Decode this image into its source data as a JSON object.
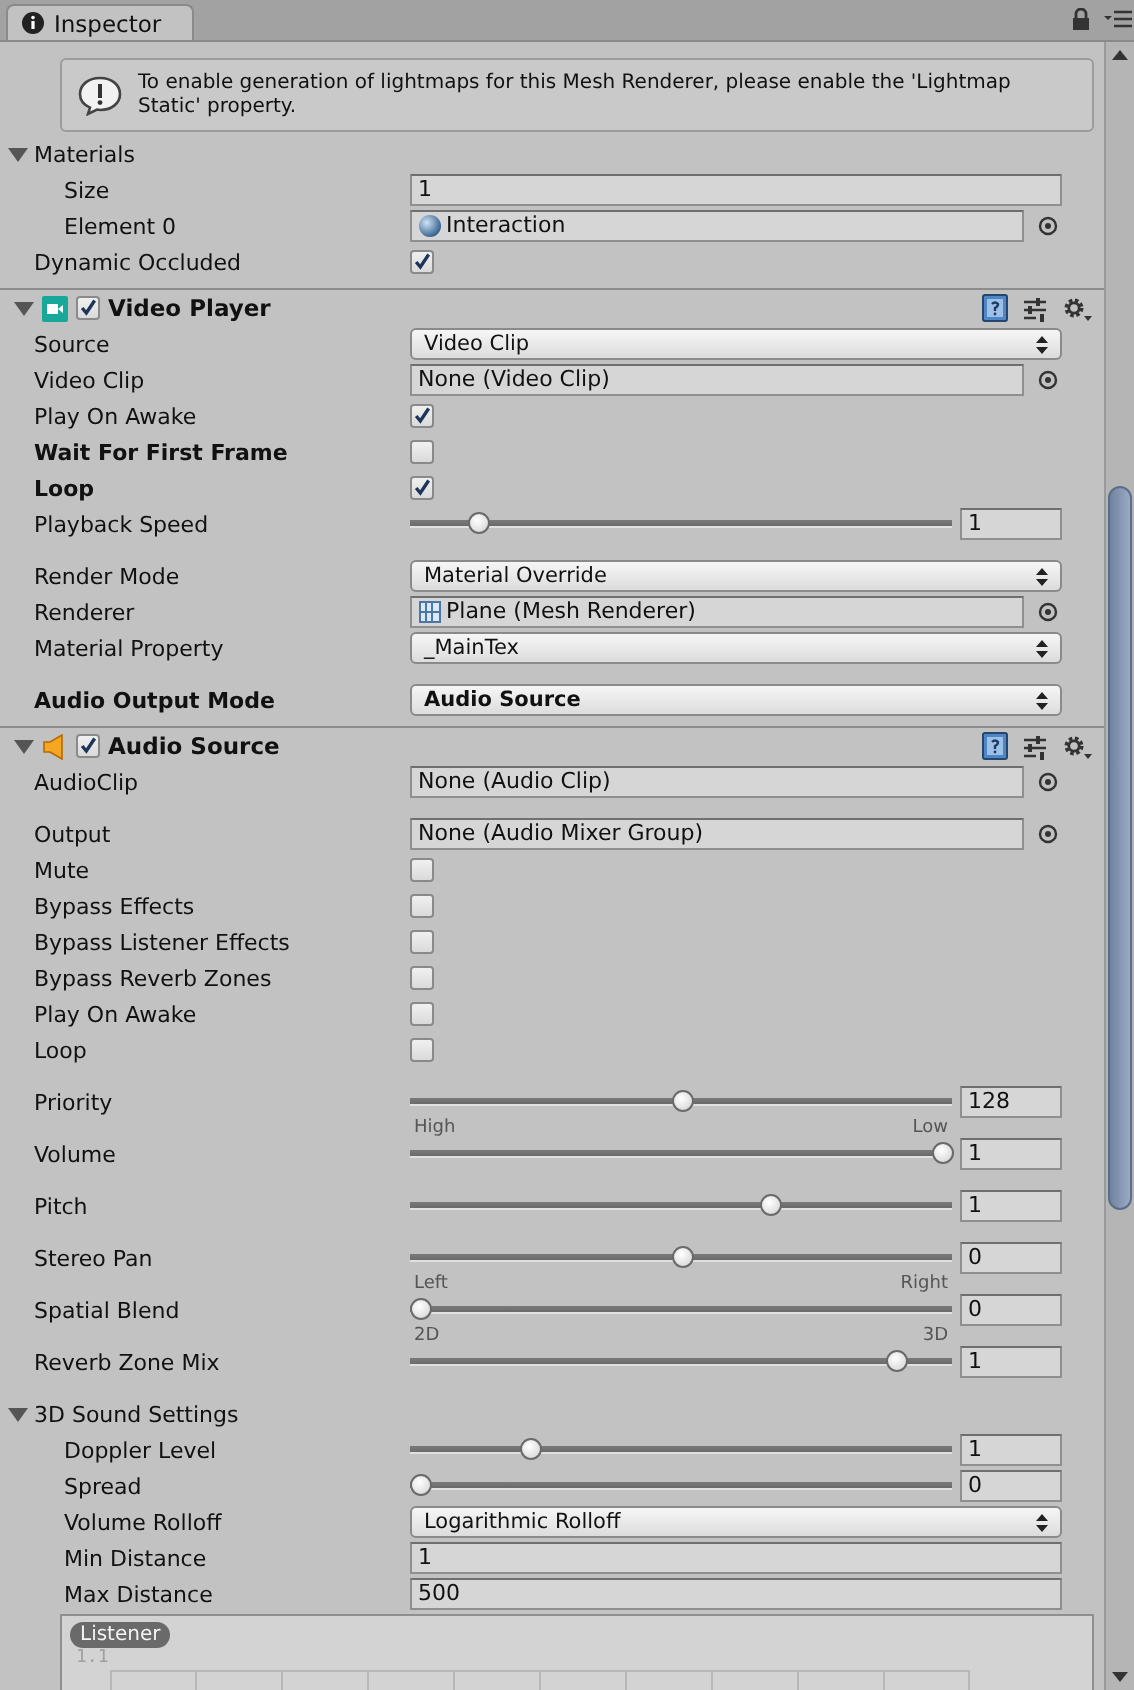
{
  "tab": {
    "title": "Inspector"
  },
  "components": [
    {
      "rows": [
        {
          "kind": "help",
          "text": "To enable generation of lightmaps for this Mesh Renderer, please enable the 'Lightmap Static' property."
        },
        {
          "kind": "foldout",
          "label": "Materials",
          "expanded": true,
          "children": [
            {
              "kind": "text",
              "label": "Size",
              "value": "1"
            },
            {
              "kind": "object",
              "label": "Element 0",
              "asset": {
                "kind": "material",
                "name": "Interaction"
              }
            }
          ]
        },
        {
          "kind": "checkbox",
          "label": "Dynamic Occluded",
          "checked": true
        }
      ]
    },
    {
      "kind": "video_player",
      "title": "Video Player",
      "enabled": true,
      "expanded": true,
      "rows": [
        {
          "kind": "dropdown",
          "label": "Source",
          "value": "Video Clip"
        },
        {
          "kind": "object",
          "label": "Video Clip",
          "value": "None (Video Clip)"
        },
        {
          "kind": "checkbox",
          "label": "Play On Awake",
          "checked": true
        },
        {
          "kind": "checkbox",
          "label": "Wait For First Frame",
          "checked": false,
          "bold": true
        },
        {
          "kind": "checkbox",
          "label": "Loop",
          "checked": true,
          "bold": true
        },
        {
          "kind": "slider",
          "label": "Playback Speed",
          "level": 0.11,
          "value": "1"
        },
        {
          "kind": "dropdown",
          "label": "Render Mode",
          "value": "Material Override",
          "spaced": true
        },
        {
          "kind": "object",
          "label": "Renderer",
          "asset": {
            "kind": "mesh_renderer",
            "name": "Plane (Mesh Renderer)"
          }
        },
        {
          "kind": "dropdown",
          "label": "Material Property",
          "value": "_MainTex"
        },
        {
          "kind": "dropdown",
          "label": "Audio Output Mode",
          "value": "Audio Source",
          "bold": true,
          "spaced": true
        }
      ]
    },
    {
      "kind": "audio_source",
      "title": "Audio Source",
      "enabled": true,
      "expanded": true,
      "rows": [
        {
          "kind": "object",
          "label": "AudioClip",
          "value": "None (Audio Clip)"
        },
        {
          "kind": "object",
          "label": "Output",
          "value": "None (Audio Mixer Group)",
          "spaced": true
        },
        {
          "kind": "checkbox",
          "label": "Mute",
          "checked": false
        },
        {
          "kind": "checkbox",
          "label": "Bypass Effects",
          "checked": false
        },
        {
          "kind": "checkbox",
          "label": "Bypass Listener Effects",
          "checked": false
        },
        {
          "kind": "checkbox",
          "label": "Bypass Reverb Zones",
          "checked": false
        },
        {
          "kind": "checkbox",
          "label": "Play On Awake",
          "checked": false
        },
        {
          "kind": "checkbox",
          "label": "Loop",
          "checked": false
        },
        {
          "kind": "slider",
          "label": "Priority",
          "level": 0.5,
          "value": "128",
          "min_label": "High",
          "max_label": "Low",
          "spaced": true
        },
        {
          "kind": "slider",
          "label": "Volume",
          "level": 1,
          "value": "1"
        },
        {
          "kind": "slider",
          "label": "Pitch",
          "level": 0.67,
          "value": "1",
          "spaced": true
        },
        {
          "kind": "slider",
          "label": "Stereo Pan",
          "level": 0.5,
          "value": "0",
          "min_label": "Left",
          "max_label": "Right",
          "spaced": true
        },
        {
          "kind": "slider",
          "label": "Spatial Blend",
          "level": 0,
          "value": "0",
          "min_label": "2D",
          "max_label": "3D"
        },
        {
          "kind": "slider",
          "label": "Reverb Zone Mix",
          "level": 0.91,
          "value": "1"
        },
        {
          "kind": "foldout",
          "label": "3D Sound Settings",
          "expanded": true,
          "spaced": true,
          "children": [
            {
              "kind": "slider",
              "label": "Doppler Level",
              "level": 0.21,
              "value": "1"
            },
            {
              "kind": "slider",
              "label": "Spread",
              "level": 0,
              "value": "0"
            },
            {
              "kind": "dropdown",
              "label": "Volume Rolloff",
              "value": "Logarithmic Rolloff"
            },
            {
              "kind": "text",
              "label": "Min Distance",
              "value": "1"
            },
            {
              "kind": "text",
              "label": "Max Distance",
              "value": "500"
            },
            {
              "kind": "curve",
              "badge": "Listener",
              "y_tick": "1.1"
            }
          ]
        }
      ]
    }
  ]
}
